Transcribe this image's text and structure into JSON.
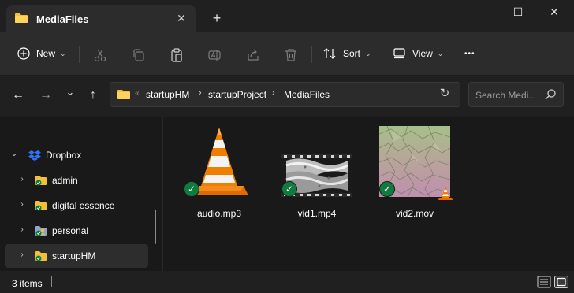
{
  "window": {
    "tab_title": "MediaFiles",
    "tab_close_glyph": "✕",
    "new_tab_glyph": "+",
    "minimize_glyph": "—",
    "maximize_glyph": "☐",
    "close_glyph": "✕"
  },
  "commandbar": {
    "new_label": "New",
    "sort_label": "Sort",
    "view_label": "View",
    "more_glyph": "•••",
    "icons": [
      "plus-circle-icon",
      "cut-icon",
      "copy-icon",
      "paste-icon",
      "rename-icon",
      "share-icon",
      "delete-icon",
      "sort-icon",
      "view-icon",
      "more-icon"
    ]
  },
  "navigation": {
    "back_glyph": "←",
    "forward_glyph": "→",
    "recent_glyph": "⌄",
    "up_glyph": "↑"
  },
  "address": {
    "overflow_glyph": "«",
    "breadcrumbs": [
      "startupHM",
      "startupProject",
      "MediaFiles"
    ],
    "separator_glyph": "›",
    "dropdown_glyph": "⌄",
    "refresh_glyph": "↻"
  },
  "search": {
    "placeholder": "Search Medi..."
  },
  "tree": {
    "root": {
      "label": "Dropbox",
      "expanded": true
    },
    "children": [
      {
        "label": "admin",
        "selected": false
      },
      {
        "label": "digital essence",
        "selected": false
      },
      {
        "label": "personal",
        "selected": false
      },
      {
        "label": "startupHM",
        "selected": true
      }
    ]
  },
  "files": [
    {
      "name": "audio.mp3",
      "thumbnail": "vlc-cone-icon",
      "sync_status": "synced"
    },
    {
      "name": "vid1.mp4",
      "thumbnail": "film-strip-thumbnail",
      "sync_status": "synced"
    },
    {
      "name": "vid2.mov",
      "thumbnail": "crumpled-texture-thumbnail",
      "sync_status": "synced"
    }
  ],
  "status": {
    "item_count": "3 items"
  },
  "colors": {
    "accent_green": "#0f7b3f",
    "folder_yellow": "#f3c03c",
    "vlc_orange": "#f07f00",
    "dropbox_blue": "#2f73f6"
  }
}
